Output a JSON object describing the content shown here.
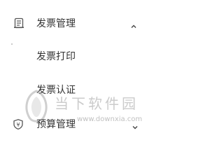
{
  "sidebar": {
    "sections": [
      {
        "label": "发票管理",
        "icon": "invoice-icon",
        "expanded": true,
        "chevron": "chevron-up-icon",
        "items": [
          {
            "label": "发票打印"
          },
          {
            "label": "发票认证"
          }
        ]
      },
      {
        "label": "预算管理",
        "icon": "budget-shield-icon",
        "expanded": false,
        "chevron": "chevron-down-icon"
      }
    ]
  },
  "watermark": {
    "title": "当下软件园",
    "url": "www.downxia.com"
  },
  "colors": {
    "text": "#333333",
    "icon": "#555555",
    "watermark": "#a0a0a0"
  }
}
